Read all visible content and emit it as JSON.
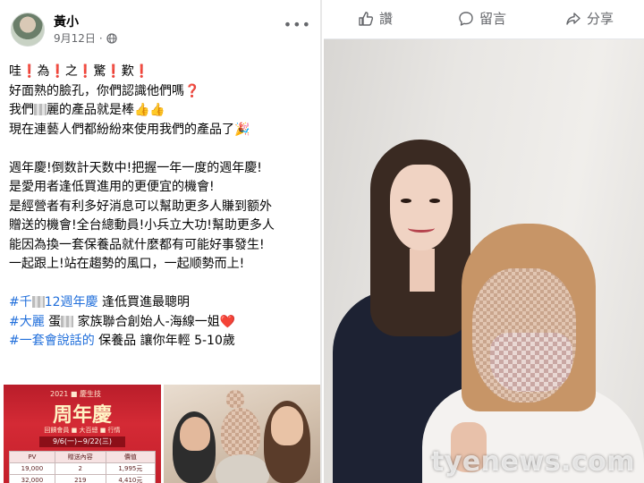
{
  "left_post": {
    "author_name": "黃小",
    "date": "9月12日",
    "privacy_icon": "globe-icon",
    "more_icon": "more-horizontal-icon",
    "line1": {
      "pre": "哇",
      "m1": "❗",
      "w1": "為",
      "m2": "❗",
      "w2": "之",
      "m3": "❗",
      "w3": "驚",
      "m4": "❗",
      "w4": "歎",
      "m5": "❗"
    },
    "line2": {
      "text": "好面熟的臉孔，你們認識他們嗎",
      "mark": "❓"
    },
    "line3": {
      "pre": "我們",
      "post": "麗的產品就是棒",
      "emoji": "👍👍"
    },
    "line4": {
      "text": "現在連藝人們都紛紛來使用我們的產品了",
      "emoji": "🎉"
    },
    "para2": [
      "週年慶!倒数計天数中!把握一年一度的週年慶!",
      "是愛用者逢低買進用的更便宜的機會!",
      "是經營者有利多好消息可以幫助更多人賺到额外",
      "贈送的機會!全台總動員!小兵立大功!幫助更多人",
      "能因為換一套保養品就什麼都有可能好事發生!",
      "一起跟上!站在趨勢的風口，一起顺勢而上!"
    ],
    "hashtags": {
      "h1_pre": "#千",
      "h1_link": "12週年慶",
      "h1_text": " 逢低買進最聰明",
      "h2_link": "#大麗",
      "h2_mid": " 蛋",
      "h2_text": " 家族聯合創始人-海線一姐",
      "h2_emoji": "❤️",
      "h3_link": "#一套會說話的",
      "h3_text": " 保養品 讓你年輕 5-10歲"
    },
    "thumb1": {
      "badge": "2021 ■ 慶生技",
      "title": "周年慶",
      "subtitle": "回饋會員 ■ 大百總 ■ 行情",
      "dates": "9/6(一)~9/22(三)",
      "headers": [
        "PV",
        "贈送內容",
        "價值"
      ],
      "rows": [
        [
          "19,000",
          "2",
          "1,995元"
        ],
        [
          "32,000",
          "219",
          "4,410元"
        ]
      ]
    }
  },
  "right_post": {
    "actions": [
      {
        "label": "讚",
        "icon": "thumbs-up-icon"
      },
      {
        "label": "留言",
        "icon": "comment-icon"
      },
      {
        "label": "分享",
        "icon": "share-icon"
      }
    ],
    "watermark": "tyenews.com"
  }
}
